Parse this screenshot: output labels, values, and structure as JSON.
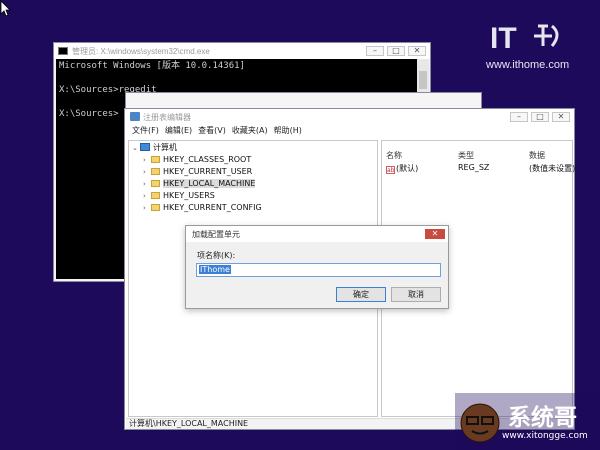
{
  "watermark_top": {
    "logo_text": "IT之家",
    "url": "www.ithome.com"
  },
  "cmd": {
    "title": "管理员: X:\\windows\\system32\\cmd.exe",
    "lines": [
      "Microsoft Windows [版本 10.0.14361]",
      "",
      "X:\\Sources>regedit",
      "",
      "X:\\Sources>"
    ]
  },
  "regedit": {
    "title": "注册表编辑器",
    "menu": [
      "文件(F)",
      "编辑(E)",
      "查看(V)",
      "收藏夹(A)",
      "帮助(H)"
    ],
    "tree_root": "计算机",
    "tree_items": [
      "HKEY_CLASSES_ROOT",
      "HKEY_CURRENT_USER",
      "HKEY_LOCAL_MACHINE",
      "HKEY_USERS",
      "HKEY_CURRENT_CONFIG"
    ],
    "selected_item": "HKEY_LOCAL_MACHINE",
    "columns": [
      "名称",
      "类型",
      "数据"
    ],
    "rows": [
      {
        "name": "(默认)",
        "type": "REG_SZ",
        "data": "(数值未设置)"
      }
    ],
    "status": "计算机\\HKEY_LOCAL_MACHINE"
  },
  "dialog": {
    "title": "加载配置单元",
    "field_label": "项名称(K):",
    "field_value": "IThome",
    "ok": "确定",
    "cancel": "取消"
  },
  "watermark_bottom": {
    "title": "系统哥",
    "url": "www.xitongge.com"
  },
  "colors": {
    "desktop": "#1e0a5a",
    "selection": "#3c7fd6",
    "close": "#c94a3f"
  }
}
